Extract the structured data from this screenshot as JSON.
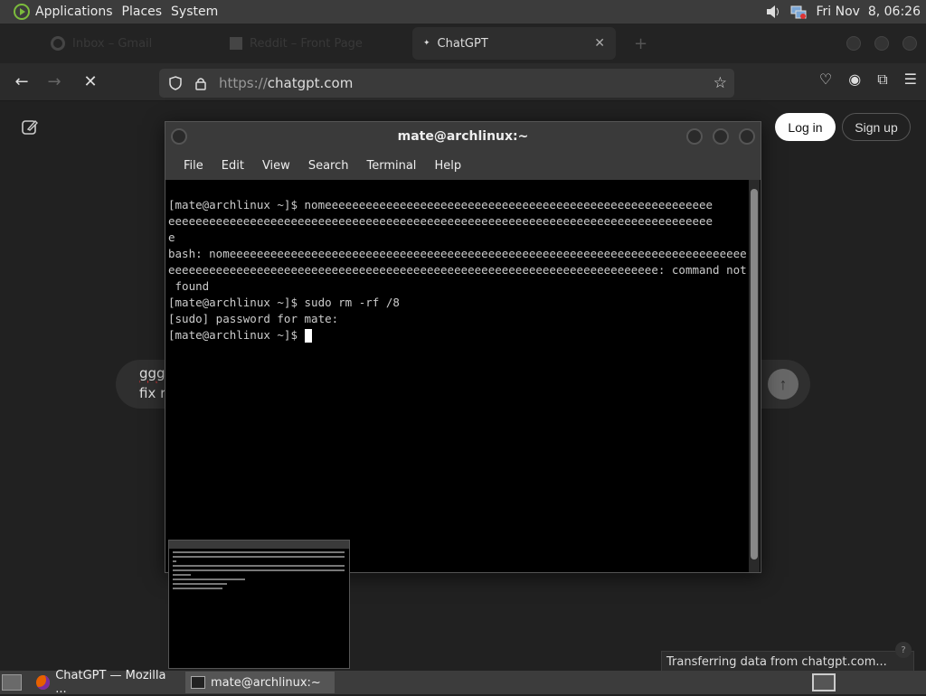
{
  "top_panel": {
    "menus": [
      "Applications",
      "Places",
      "System"
    ],
    "clock": "Fri Nov  8, 06:26"
  },
  "browser": {
    "tabs": [
      {
        "label": "Inbox – Gmail",
        "faded": true
      },
      {
        "label": "Reddit – Front Page",
        "faded": true
      },
      {
        "label": "ChatGPT",
        "active": true
      }
    ],
    "url_protocol": "https://",
    "url_host": "chatgpt.com"
  },
  "page": {
    "login_label": "Log in",
    "signup_label": "Sign up",
    "composer_line1": "ggg",
    "composer_line2": "fix r",
    "status_text": "Transferring data from chatgpt.com...",
    "help_mini": "?"
  },
  "terminal": {
    "title": "mate@archlinux:~",
    "menu": [
      "File",
      "Edit",
      "View",
      "Search",
      "Terminal",
      "Help"
    ],
    "lines": [
      "[mate@archlinux ~]$ nomeeeeeeeeeeeeeeeeeeeeeeeeeeeeeeeeeeeeeeeeeeeeeeeeeeeeeeeee",
      "eeeeeeeeeeeeeeeeeeeeeeeeeeeeeeeeeeeeeeeeeeeeeeeeeeeeeeeeeeeeeeeeeeeeeeeeeeeeeeee",
      "e",
      "bash: nomeeeeeeeeeeeeeeeeeeeeeeeeeeeeeeeeeeeeeeeeeeeeeeeeeeeeeeeeeeeeeeeeeeeeeeeeeeee",
      "eeeeeeeeeeeeeeeeeeeeeeeeeeeeeeeeeeeeeeeeeeeeeeeeeeeeeeeeeeeeeeeeeeeeeeee: command not",
      " found",
      "[mate@archlinux ~]$ sudo rm -rf /8",
      "[sudo] password for mate:",
      "[mate@archlinux ~]$ "
    ]
  },
  "bottom_panel": {
    "tasks": [
      {
        "label": "ChatGPT — Mozilla ...",
        "icon": "firefox-icon"
      },
      {
        "label": "mate@archlinux:~",
        "icon": "terminal-icon",
        "active": true
      }
    ]
  }
}
